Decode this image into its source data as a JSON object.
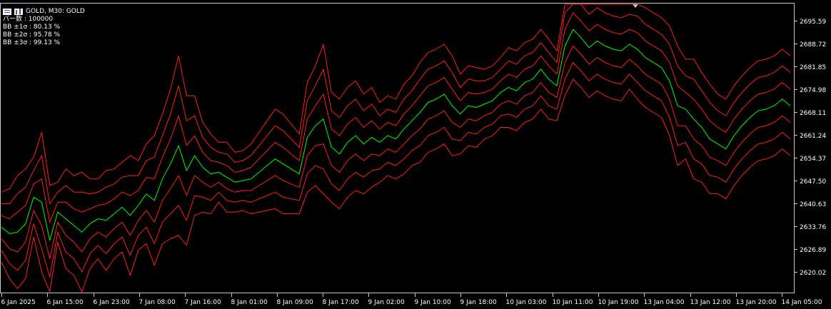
{
  "header": {
    "title": "GOLD, M30:  GOLD",
    "info_lines": [
      "バー数 : 100000",
      "BB ±1σ : 80.13 %",
      "BB ±2σ : 95.78 %",
      "BB ±3σ : 99.13 %"
    ]
  },
  "colors": {
    "background": "#000000",
    "axis": "#c8c8c8",
    "mid_band": "#00ff00",
    "outer_bands": "#ff1e1e"
  },
  "chart_data": {
    "type": "line",
    "y_axis": {
      "ticks": [
        2695.59,
        2688.72,
        2681.85,
        2674.98,
        2668.11,
        2661.24,
        2654.37,
        2647.5,
        2640.63,
        2633.76,
        2626.89,
        2620.02
      ],
      "range": [
        2614.5,
        2700.5
      ]
    },
    "x_axis": {
      "labels": [
        "6 Jan 2025",
        "6 Jan 15:00",
        "6 Jan 23:00",
        "7 Jan 08:00",
        "7 Jan 16:00",
        "8 Jan 01:00",
        "8 Jan 09:00",
        "8 Jan 17:00",
        "9 Jan 02:00",
        "9 Jan 10:00",
        "9 Jan 18:00",
        "10 Jan 03:00",
        "10 Jan 11:00",
        "10 Jan 19:00",
        "13 Jan 04:00",
        "13 Jan 12:00",
        "13 Jan 20:00",
        "14 Jan 05:00"
      ]
    },
    "series": [
      {
        "role": "middle",
        "values": [
          2633.5,
          2631.5,
          2632.0,
          2634.5,
          2642.5,
          2641.0,
          2629.5,
          2638.0,
          2636.0,
          2634.0,
          2632.0,
          2634.5,
          2636.0,
          2635.5,
          2637.5,
          2639.5,
          2637.0,
          2640.0,
          2643.5,
          2641.5,
          2648.0,
          2652.5,
          2658.0,
          2650.5,
          2655.0,
          2651.5,
          2649.5,
          2650.0,
          2648.5,
          2647.0,
          2647.5,
          2648.0,
          2650.0,
          2652.0,
          2654.0,
          2652.5,
          2651.0,
          2649.5,
          2660.5,
          2664.0,
          2666.0,
          2657.5,
          2655.5,
          2659.0,
          2661.0,
          2658.5,
          2660.5,
          2659.0,
          2661.0,
          2660.0,
          2663.0,
          2665.5,
          2668.0,
          2671.0,
          2672.0,
          2673.5,
          2670.0,
          2667.5,
          2670.0,
          2669.5,
          2670.5,
          2671.5,
          2674.0,
          2675.5,
          2674.5,
          2677.0,
          2678.0,
          2681.0,
          2678.0,
          2676.0,
          2688.0,
          2693.0,
          2690.5,
          2687.5,
          2689.5,
          2688.0,
          2687.0,
          2686.5,
          2688.5,
          2687.0,
          2684.5,
          2683.0,
          2681.5,
          2677.5,
          2670.0,
          2669.0,
          2666.0,
          2663.5,
          2660.0,
          2658.5,
          2657.0,
          2661.0,
          2664.0,
          2666.5,
          2668.5,
          2669.0,
          2670.0,
          2672.0,
          2670.0
        ]
      },
      {
        "role": "upper_1",
        "values": [
          2637.0,
          2636.0,
          2638.0,
          2640.0,
          2646.5,
          2648.0,
          2635.0,
          2641.0,
          2641.0,
          2639.0,
          2638.0,
          2639.0,
          2640.0,
          2640.5,
          2642.0,
          2644.0,
          2643.0,
          2644.5,
          2648.5,
          2648.0,
          2654.5,
          2660.0,
          2667.0,
          2658.0,
          2661.0,
          2656.0,
          2653.5,
          2653.0,
          2652.0,
          2650.0,
          2650.5,
          2651.5,
          2654.0,
          2656.5,
          2659.0,
          2657.5,
          2655.5,
          2653.5,
          2666.0,
          2670.0,
          2673.5,
          2663.0,
          2661.0,
          2664.5,
          2666.5,
          2663.5,
          2665.5,
          2663.0,
          2665.0,
          2664.0,
          2667.5,
          2670.0,
          2673.0,
          2676.0,
          2677.0,
          2678.5,
          2675.0,
          2671.5,
          2674.0,
          2673.5,
          2674.0,
          2675.0,
          2677.5,
          2679.5,
          2678.5,
          2681.0,
          2682.0,
          2685.0,
          2682.0,
          2679.5,
          2693.0,
          2698.0,
          2695.5,
          2692.5,
          2694.5,
          2693.0,
          2692.0,
          2691.5,
          2693.0,
          2692.0,
          2689.5,
          2688.0,
          2686.5,
          2683.0,
          2676.0,
          2674.0,
          2672.0,
          2669.0,
          2665.5,
          2663.5,
          2662.0,
          2666.0,
          2669.0,
          2671.5,
          2673.5,
          2674.0,
          2675.0,
          2677.0,
          2675.0
        ]
      },
      {
        "role": "upper_2",
        "values": [
          2640.5,
          2640.5,
          2643.5,
          2645.5,
          2650.5,
          2655.0,
          2640.5,
          2644.0,
          2646.0,
          2644.0,
          2644.0,
          2643.5,
          2644.0,
          2645.5,
          2646.5,
          2648.5,
          2649.0,
          2649.0,
          2653.5,
          2654.5,
          2661.0,
          2667.5,
          2676.0,
          2665.5,
          2667.0,
          2660.5,
          2657.5,
          2656.0,
          2655.5,
          2653.0,
          2653.5,
          2655.0,
          2658.0,
          2661.0,
          2664.0,
          2662.5,
          2660.0,
          2657.5,
          2671.5,
          2676.0,
          2681.0,
          2668.5,
          2666.5,
          2670.0,
          2672.0,
          2668.5,
          2670.5,
          2667.0,
          2669.0,
          2668.0,
          2672.0,
          2674.5,
          2678.0,
          2681.0,
          2682.0,
          2683.5,
          2680.0,
          2675.5,
          2678.0,
          2677.5,
          2677.5,
          2678.5,
          2681.0,
          2683.5,
          2682.5,
          2685.0,
          2686.0,
          2689.0,
          2686.0,
          2683.0,
          2698.0,
          2703.0,
          2700.5,
          2697.5,
          2699.5,
          2698.0,
          2697.0,
          2696.5,
          2697.5,
          2697.0,
          2694.5,
          2693.0,
          2691.5,
          2688.5,
          2682.0,
          2679.0,
          2678.0,
          2674.5,
          2671.0,
          2668.5,
          2667.0,
          2671.0,
          2674.0,
          2676.5,
          2678.5,
          2679.0,
          2680.0,
          2682.0,
          2680.0
        ]
      },
      {
        "role": "upper_3",
        "values": [
          2644.0,
          2645.0,
          2649.0,
          2651.0,
          2654.5,
          2662.0,
          2646.0,
          2647.0,
          2651.0,
          2649.0,
          2650.0,
          2648.0,
          2648.0,
          2650.5,
          2651.0,
          2653.0,
          2655.0,
          2653.5,
          2658.5,
          2661.0,
          2667.5,
          2675.0,
          2685.0,
          2673.0,
          2673.0,
          2665.0,
          2661.5,
          2659.0,
          2659.0,
          2656.0,
          2656.5,
          2658.5,
          2662.0,
          2665.5,
          2669.0,
          2667.5,
          2664.5,
          2661.5,
          2677.0,
          2682.0,
          2688.5,
          2674.0,
          2672.0,
          2675.5,
          2677.5,
          2673.5,
          2675.5,
          2671.0,
          2673.0,
          2672.0,
          2676.5,
          2679.0,
          2683.0,
          2686.0,
          2687.0,
          2688.5,
          2685.0,
          2679.5,
          2682.0,
          2681.5,
          2681.0,
          2682.0,
          2684.5,
          2687.5,
          2686.5,
          2689.0,
          2690.0,
          2693.0,
          2690.0,
          2686.5,
          2703.0,
          2708.0,
          2705.5,
          2702.5,
          2704.5,
          2703.0,
          2702.0,
          2701.5,
          2702.0,
          2702.0,
          2699.5,
          2698.0,
          2696.5,
          2694.0,
          2688.0,
          2684.0,
          2684.0,
          2680.0,
          2676.5,
          2673.5,
          2672.0,
          2676.0,
          2679.0,
          2681.5,
          2683.5,
          2684.0,
          2685.0,
          2687.0,
          2685.0
        ]
      },
      {
        "role": "lower_1",
        "values": [
          2630.0,
          2627.0,
          2626.0,
          2629.0,
          2638.5,
          2634.0,
          2624.0,
          2635.0,
          2631.0,
          2629.0,
          2626.0,
          2630.0,
          2632.0,
          2630.5,
          2633.0,
          2635.0,
          2631.0,
          2635.5,
          2638.5,
          2635.0,
          2641.5,
          2645.0,
          2649.0,
          2643.0,
          2649.0,
          2647.0,
          2645.5,
          2647.0,
          2645.0,
          2644.0,
          2644.5,
          2644.5,
          2646.0,
          2647.5,
          2649.0,
          2647.5,
          2646.5,
          2645.5,
          2655.0,
          2658.0,
          2658.5,
          2652.0,
          2650.0,
          2653.5,
          2655.5,
          2653.5,
          2655.5,
          2655.0,
          2657.0,
          2656.0,
          2658.5,
          2661.0,
          2663.0,
          2666.0,
          2667.0,
          2668.5,
          2665.0,
          2663.5,
          2666.0,
          2665.5,
          2667.0,
          2668.0,
          2670.5,
          2671.5,
          2670.5,
          2673.0,
          2674.0,
          2677.0,
          2674.0,
          2672.5,
          2683.0,
          2688.0,
          2685.5,
          2682.5,
          2684.5,
          2683.0,
          2682.0,
          2681.5,
          2684.0,
          2682.0,
          2679.5,
          2678.0,
          2676.5,
          2672.0,
          2664.0,
          2664.0,
          2660.0,
          2658.0,
          2654.5,
          2653.5,
          2652.0,
          2656.0,
          2659.0,
          2661.5,
          2663.5,
          2664.0,
          2665.0,
          2667.0,
          2665.0
        ]
      },
      {
        "role": "lower_2",
        "values": [
          2626.5,
          2622.5,
          2620.5,
          2623.5,
          2634.5,
          2627.0,
          2618.5,
          2632.0,
          2626.0,
          2624.0,
          2620.0,
          2625.5,
          2628.0,
          2625.5,
          2628.5,
          2630.5,
          2625.0,
          2631.0,
          2633.5,
          2628.5,
          2635.0,
          2637.5,
          2640.0,
          2635.5,
          2643.0,
          2642.5,
          2641.5,
          2644.0,
          2641.5,
          2641.0,
          2641.5,
          2641.0,
          2642.0,
          2643.0,
          2644.0,
          2642.5,
          2642.0,
          2641.5,
          2649.5,
          2652.0,
          2651.0,
          2646.5,
          2644.5,
          2648.0,
          2650.0,
          2648.5,
          2650.5,
          2651.0,
          2653.0,
          2652.0,
          2654.0,
          2656.5,
          2658.0,
          2661.0,
          2662.0,
          2663.5,
          2660.0,
          2659.5,
          2662.0,
          2661.5,
          2663.5,
          2664.5,
          2667.0,
          2667.5,
          2666.5,
          2669.0,
          2670.0,
          2673.0,
          2670.0,
          2669.0,
          2678.0,
          2683.0,
          2680.5,
          2677.5,
          2679.5,
          2678.0,
          2677.0,
          2676.5,
          2679.5,
          2677.0,
          2674.5,
          2673.0,
          2671.5,
          2666.5,
          2658.0,
          2659.0,
          2654.0,
          2652.5,
          2649.0,
          2648.5,
          2647.0,
          2651.0,
          2654.0,
          2656.5,
          2658.5,
          2659.0,
          2660.0,
          2662.0,
          2660.0
        ]
      },
      {
        "role": "lower_3",
        "values": [
          2623.0,
          2618.0,
          2615.0,
          2618.0,
          2630.5,
          2620.0,
          2613.0,
          2629.0,
          2621.0,
          2619.0,
          2614.0,
          2621.0,
          2624.0,
          2620.5,
          2624.0,
          2626.0,
          2619.0,
          2626.5,
          2628.5,
          2622.0,
          2628.5,
          2630.0,
          2631.0,
          2628.0,
          2637.0,
          2638.0,
          2637.5,
          2641.0,
          2638.0,
          2638.0,
          2638.5,
          2637.5,
          2638.0,
          2638.5,
          2639.0,
          2637.5,
          2637.5,
          2637.5,
          2644.0,
          2646.0,
          2643.5,
          2641.0,
          2639.0,
          2642.5,
          2644.5,
          2643.5,
          2645.5,
          2647.0,
          2649.0,
          2648.0,
          2649.5,
          2652.0,
          2653.0,
          2656.0,
          2657.0,
          2658.5,
          2655.0,
          2655.5,
          2658.0,
          2657.5,
          2660.0,
          2661.0,
          2663.5,
          2663.5,
          2662.5,
          2665.0,
          2666.0,
          2669.0,
          2666.0,
          2665.5,
          2673.0,
          2678.0,
          2675.5,
          2672.5,
          2674.5,
          2673.0,
          2672.0,
          2671.5,
          2675.0,
          2672.0,
          2669.5,
          2668.0,
          2666.5,
          2661.0,
          2652.0,
          2654.0,
          2648.0,
          2647.0,
          2643.5,
          2643.5,
          2642.0,
          2646.0,
          2649.0,
          2651.5,
          2653.5,
          2654.0,
          2655.0,
          2657.0,
          2655.0
        ]
      }
    ]
  }
}
